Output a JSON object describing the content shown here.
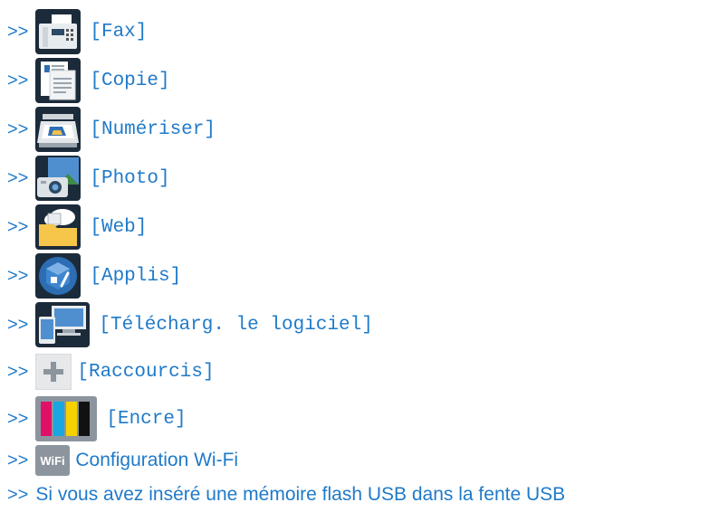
{
  "items": [
    {
      "arrow": ">>",
      "label": "[Fax]",
      "icon": "fax-icon"
    },
    {
      "arrow": ">>",
      "label": "[Copie]",
      "icon": "copy-icon"
    },
    {
      "arrow": ">>",
      "label": "[Numériser]",
      "icon": "scan-icon"
    },
    {
      "arrow": ">>",
      "label": "[Photo]",
      "icon": "photo-icon"
    },
    {
      "arrow": ">>",
      "label": "[Web]",
      "icon": "web-icon"
    },
    {
      "arrow": ">>",
      "label": "[Applis]",
      "icon": "apps-icon"
    },
    {
      "arrow": ">>",
      "label": "[Télécharg. le logiciel]",
      "icon": "download-software-icon"
    },
    {
      "arrow": ">>",
      "label": "[Raccourcis]",
      "icon": "shortcuts-icon"
    },
    {
      "arrow": ">>",
      "label": "[Encre]",
      "icon": "ink-icon"
    },
    {
      "arrow": ">>",
      "label": "Configuration Wi-Fi",
      "icon": "wifi-icon",
      "icon_text": "WiFi"
    },
    {
      "arrow": ">>",
      "label": "Si vous avez inséré une mémoire flash USB dans la fente USB"
    }
  ]
}
